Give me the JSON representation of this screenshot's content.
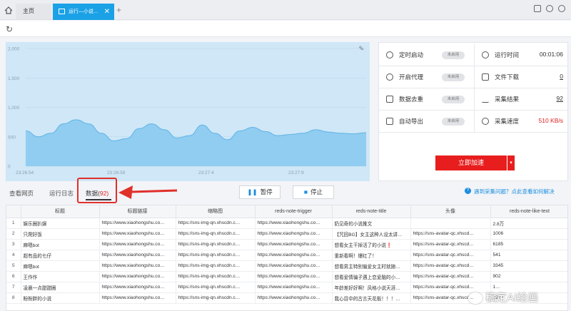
{
  "tabs": {
    "home_label": "主页",
    "active_label": "运行—小说…",
    "close_symbol": "✕",
    "add_symbol": "+"
  },
  "chart_data": {
    "type": "area",
    "title": "",
    "x_tick_labels": [
      "23:26:54",
      "23:26:59",
      "23:27:4",
      "23:27:9"
    ],
    "y_tick_labels": [
      "0",
      "500",
      "1,000",
      "1,500",
      "2,000"
    ],
    "ylim": [
      0,
      2000
    ],
    "grid": true,
    "series": [
      {
        "values": [
          600,
          500,
          560,
          720,
          790,
          720,
          560,
          430,
          470,
          640,
          720,
          620,
          480,
          520,
          700,
          560,
          450,
          600,
          660,
          590,
          520,
          540,
          560,
          620,
          580,
          560,
          550,
          570
        ]
      }
    ],
    "color": "#7cc4ef"
  },
  "stats": {
    "schedule_label": "定时启动",
    "schedule_badge": "未启用",
    "runtime_label": "运行时间",
    "runtime_value": "00:01:06",
    "proxy_label": "开启代理",
    "proxy_badge": "未启用",
    "download_label": "文件下载",
    "download_value": "0",
    "dedup_label": "数据去重",
    "dedup_badge": "未启用",
    "result_label": "采集结果",
    "result_value": "92",
    "export_label": "自动导出",
    "export_badge": "未启用",
    "speed_label": "采集速度",
    "speed_value": "510 KB/s",
    "accelerate_label": "立即加速",
    "accelerate_drop": "▾"
  },
  "lower_tabs": {
    "view_page": "查看网页",
    "run_log": "运行日志",
    "data_label": "数据(",
    "data_count": "92",
    "data_close": ")"
  },
  "controls": {
    "pause_label": "暂停",
    "stop_label": "停止",
    "help_link": "遇到采集问题？点此查看如何解决"
  },
  "table": {
    "columns": [
      "",
      "标题",
      "标题链接",
      "缩略图",
      "reds-note-trigger",
      "reds-note-title",
      "头像",
      "reds-note-like-text"
    ],
    "rows": [
      [
        "1",
        "娱乐圈扒娱",
        "https://www.xiaohongshu.co…",
        "https://sns-img-qn.xhscdn.c…",
        "https://www.xiaohongshu.co…",
        "奶见奇的小说推文",
        "",
        "2.8万"
      ],
      [
        "2",
        "只爬好饭",
        "https://www.xiaohongshu.co…",
        "https://sns-img-qn.xhscdn.c…",
        "https://www.xiaohongshu.co…",
        "【咒回BG】女主这种人设太讲…",
        "https://sns-avatar-qc.xhscd…",
        "1006"
      ],
      [
        "3",
        "麻嗯bot",
        "https://www.xiaohongshu.co…",
        "https://sns-img-qn.xhscdn.c…",
        "https://www.xiaohongshu.co…",
        "想看女主干掉活了的小说❗",
        "https://sns-avatar-qc.xhscd…",
        "6185"
      ],
      [
        "4",
        "超有品的七仔",
        "https://www.xiaohongshu.co…",
        "https://sns-img-qn.xhscdn.c…",
        "https://www.xiaohongshu.co…",
        "重新看啊！爆红了！",
        "https://sns-avatar-qc.xhscd…",
        "541"
      ],
      [
        "5",
        "麻嗯bot",
        "https://www.xiaohongshu.co…",
        "https://sns-img-qn.xhscdn.c…",
        "https://www.xiaohongshu.co…",
        "想看男主特别偏爱女主时就随…",
        "https://sns-avatar-qc.xhscd…",
        "3345"
      ],
      [
        "6",
        "王作作",
        "https://www.xiaohongshu.co…",
        "https://sns-img-qn.xhscdn.c…",
        "https://www.xiaohongshu.co…",
        "想看爱情骗子遇上恋爱脑的小…",
        "https://sns-avatar-qc.xhscd…",
        "902"
      ],
      [
        "7",
        "凌晨一点甜甜圈",
        "https://www.xiaohongshu.co…",
        "https://sns-img-qn.xhscdn.c…",
        "https://www.xiaohongshu.co…",
        "年龄差好好啊！风格小说天涯…",
        "https://sns-avatar-qc.xhscd…",
        "1…"
      ],
      [
        "8",
        "盼盼胖的小说",
        "https://www.xiaohongshu.co…",
        "https://sns-img-qn.xhscdn.c…",
        "https://www.xiaohongshu.co…",
        "我心目中的古言天花板！！！…",
        "https://sns-avatar-qc.xhscd…",
        "2277"
      ]
    ]
  },
  "watermark": "稿定AI绘画"
}
